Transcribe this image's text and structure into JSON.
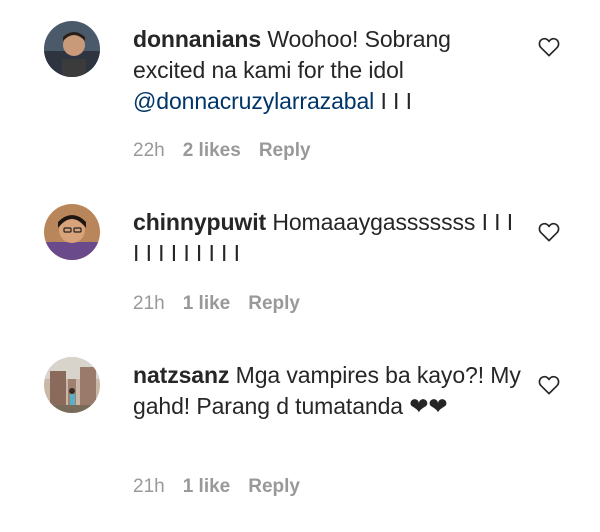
{
  "comments": [
    {
      "username": "donnanians",
      "text": "Woohoo! Sobrang excited na kami for the idol",
      "mention": "@donnacruzylarrazabal",
      "trailing": " I I I",
      "time": "22h",
      "likes": "2 likes",
      "reply": "Reply",
      "avatar": "avatar-photo",
      "like_icon": "heart-outline-icon"
    },
    {
      "username": "chinnypuwit",
      "text": "Homaaaygasssssss I I I I I I I I I I I I",
      "time": "21h",
      "likes": "1 like",
      "reply": "Reply",
      "avatar": "avatar-photo",
      "like_icon": "heart-outline-icon"
    },
    {
      "username": "natzsanz",
      "text": "Mga vampires ba kayo?! My gahd! Parang d tumatanda ❤❤",
      "time": "21h",
      "likes": "1 like",
      "reply": "Reply",
      "avatar": "avatar-photo",
      "like_icon": "heart-outline-icon"
    }
  ],
  "colors": {
    "text": "#262626",
    "meta": "#999999",
    "mention": "#003569"
  }
}
